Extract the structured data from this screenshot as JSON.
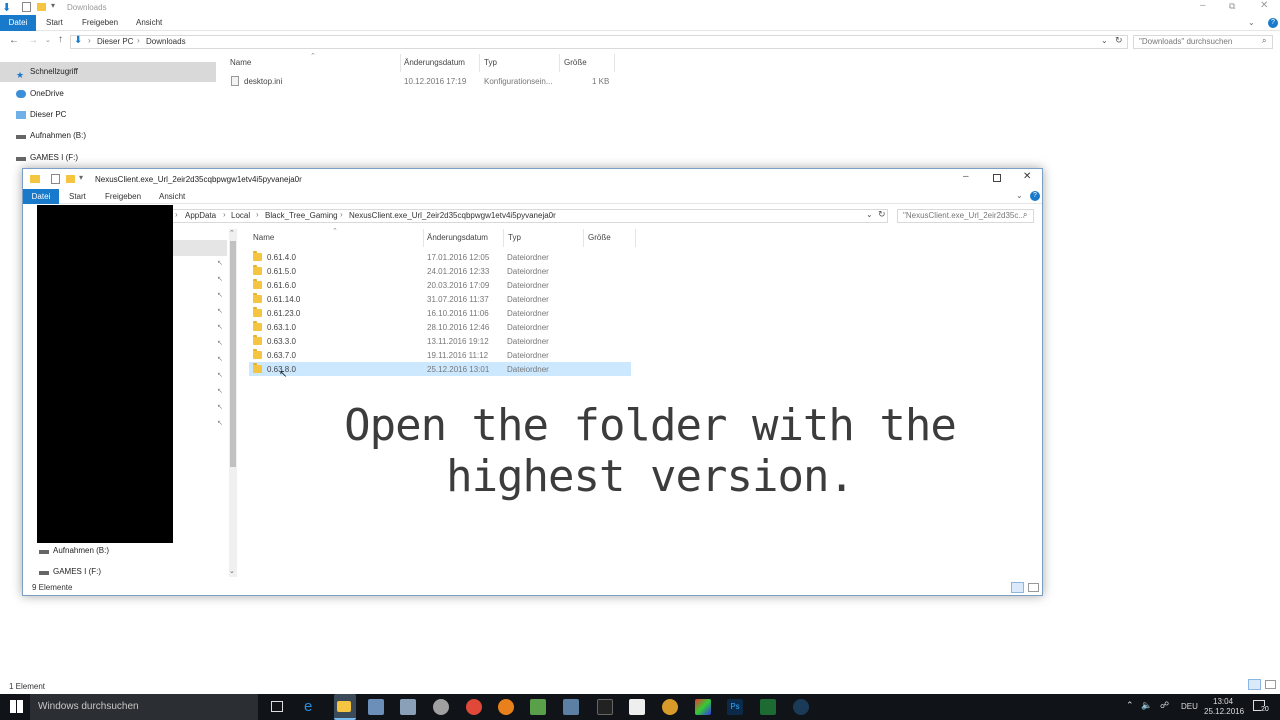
{
  "bg_window": {
    "title": "Downloads",
    "tabs": [
      "Datei",
      "Start",
      "Freigeben",
      "Ansicht"
    ],
    "breadcrumb": [
      "Dieser PC",
      "Downloads"
    ],
    "search_placeholder": "\"Downloads\" durchsuchen",
    "columns": [
      "Name",
      "Änderungsdatum",
      "Typ",
      "Größe"
    ],
    "files": [
      {
        "name": "desktop.ini",
        "date": "10.12.2016 17:19",
        "type": "Konfigurationsein...",
        "size": "1 KB"
      }
    ],
    "nav": [
      "Schnellzugriff",
      "OneDrive",
      "Dieser PC",
      "Aufnahmen (B:)",
      "GAMES I (F:)"
    ],
    "status": "1 Element"
  },
  "dialog": {
    "title": "NexusClient.exe_Url_2eir2d35cqbpwgw1etv4i5pyvaneja0r",
    "tabs": [
      "Datei",
      "Start",
      "Freigeben",
      "Ansicht"
    ],
    "breadcrumb": [
      "AppData",
      "Local",
      "Black_Tree_Gaming",
      "NexusClient.exe_Url_2eir2d35cqbpwgw1etv4i5pyvaneja0r"
    ],
    "search_placeholder": "\"NexusClient.exe_Url_2eir2d35c...",
    "columns": [
      "Name",
      "Änderungsdatum",
      "Typ",
      "Größe"
    ],
    "folders": [
      {
        "name": "0.61.4.0",
        "date": "17.01.2016 12:05",
        "type": "Dateiordner"
      },
      {
        "name": "0.61.5.0",
        "date": "24.01.2016 12:33",
        "type": "Dateiordner"
      },
      {
        "name": "0.61.6.0",
        "date": "20.03.2016 17:09",
        "type": "Dateiordner"
      },
      {
        "name": "0.61.14.0",
        "date": "31.07.2016 11:37",
        "type": "Dateiordner"
      },
      {
        "name": "0.61.23.0",
        "date": "16.10.2016 11:06",
        "type": "Dateiordner"
      },
      {
        "name": "0.63.1.0",
        "date": "28.10.2016 12:46",
        "type": "Dateiordner"
      },
      {
        "name": "0.63.3.0",
        "date": "13.11.2016 19:12",
        "type": "Dateiordner"
      },
      {
        "name": "0.63.7.0",
        "date": "19.11.2016 11:12",
        "type": "Dateiordner"
      },
      {
        "name": "0.63.8.0",
        "date": "25.12.2016 13:01",
        "type": "Dateiordner"
      }
    ],
    "nav_bottom": [
      "Aufnahmen (B:)",
      "GAMES I (F:)"
    ],
    "status": "9 Elemente"
  },
  "caption": "Open the folder with the highest version.",
  "taskbar": {
    "search_placeholder": "Windows durchsuchen",
    "language": "DEU",
    "time": "13:04",
    "date": "25.12.2016",
    "notification_count": "20"
  }
}
